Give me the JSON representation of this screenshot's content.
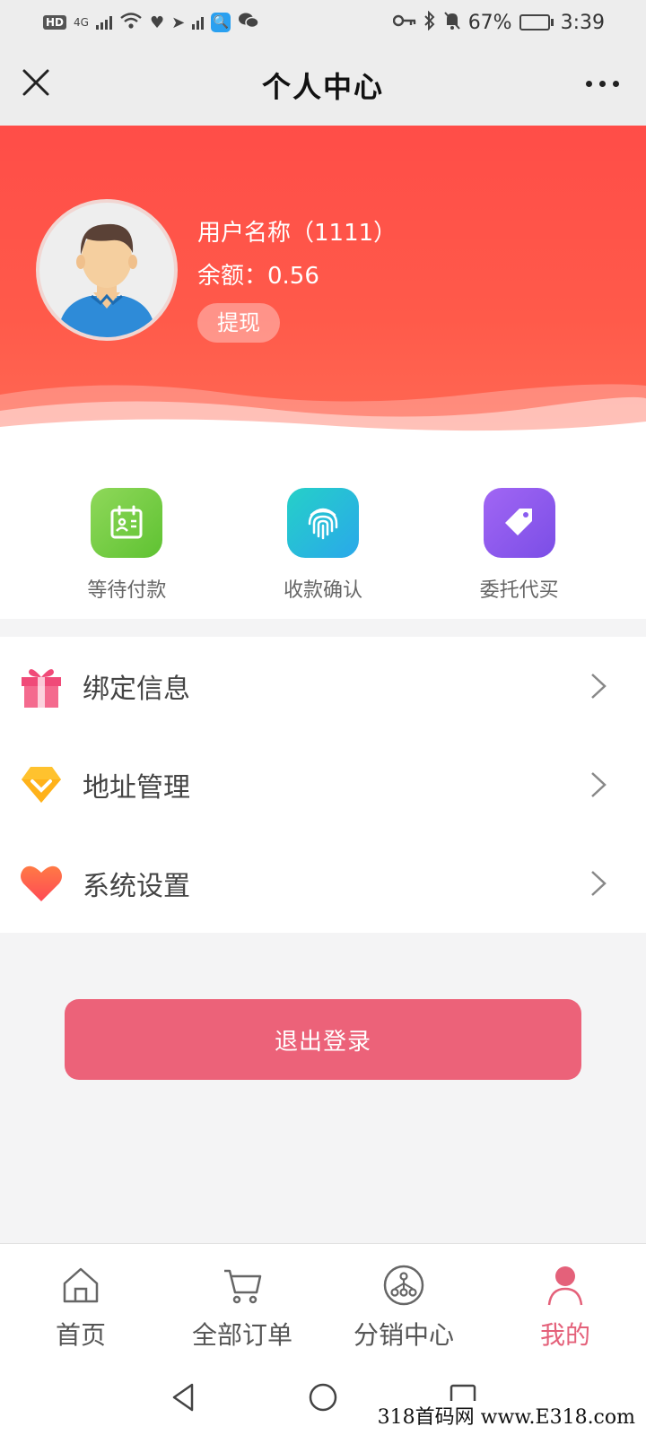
{
  "status_bar": {
    "network": "HD",
    "network_gen": "4G",
    "battery": "67%",
    "battery_level": 0.67,
    "time": "3:39"
  },
  "nav": {
    "title": "个人中心",
    "close_icon": "close-icon",
    "more_icon": "more-icon"
  },
  "profile": {
    "username": "用户名称（1111）",
    "balance": "余额：0.56",
    "withdraw_label": "提现"
  },
  "quick_actions": [
    {
      "label": "等待付款",
      "icon": "calendar-icon",
      "color": "#7ed04f"
    },
    {
      "label": "收款确认",
      "icon": "fingerprint-icon",
      "color": "#2bc1e2"
    },
    {
      "label": "委托代买",
      "icon": "tag-icon",
      "color": "#8a5cf0"
    }
  ],
  "menu": [
    {
      "label": "绑定信息",
      "icon": "gift-icon"
    },
    {
      "label": "地址管理",
      "icon": "diamond-icon"
    },
    {
      "label": "系统设置",
      "icon": "heart-icon"
    }
  ],
  "logout_label": "退出登录",
  "tabs": [
    {
      "label": "首页",
      "icon": "home-icon"
    },
    {
      "label": "全部订单",
      "icon": "cart-icon"
    },
    {
      "label": "分销中心",
      "icon": "network-icon"
    },
    {
      "label": "我的",
      "icon": "user-icon",
      "active": true
    }
  ],
  "watermark": "318首码网 www.E318.com",
  "colors": {
    "header_red": "#ff4d48",
    "accent_pink": "#ec6279"
  }
}
